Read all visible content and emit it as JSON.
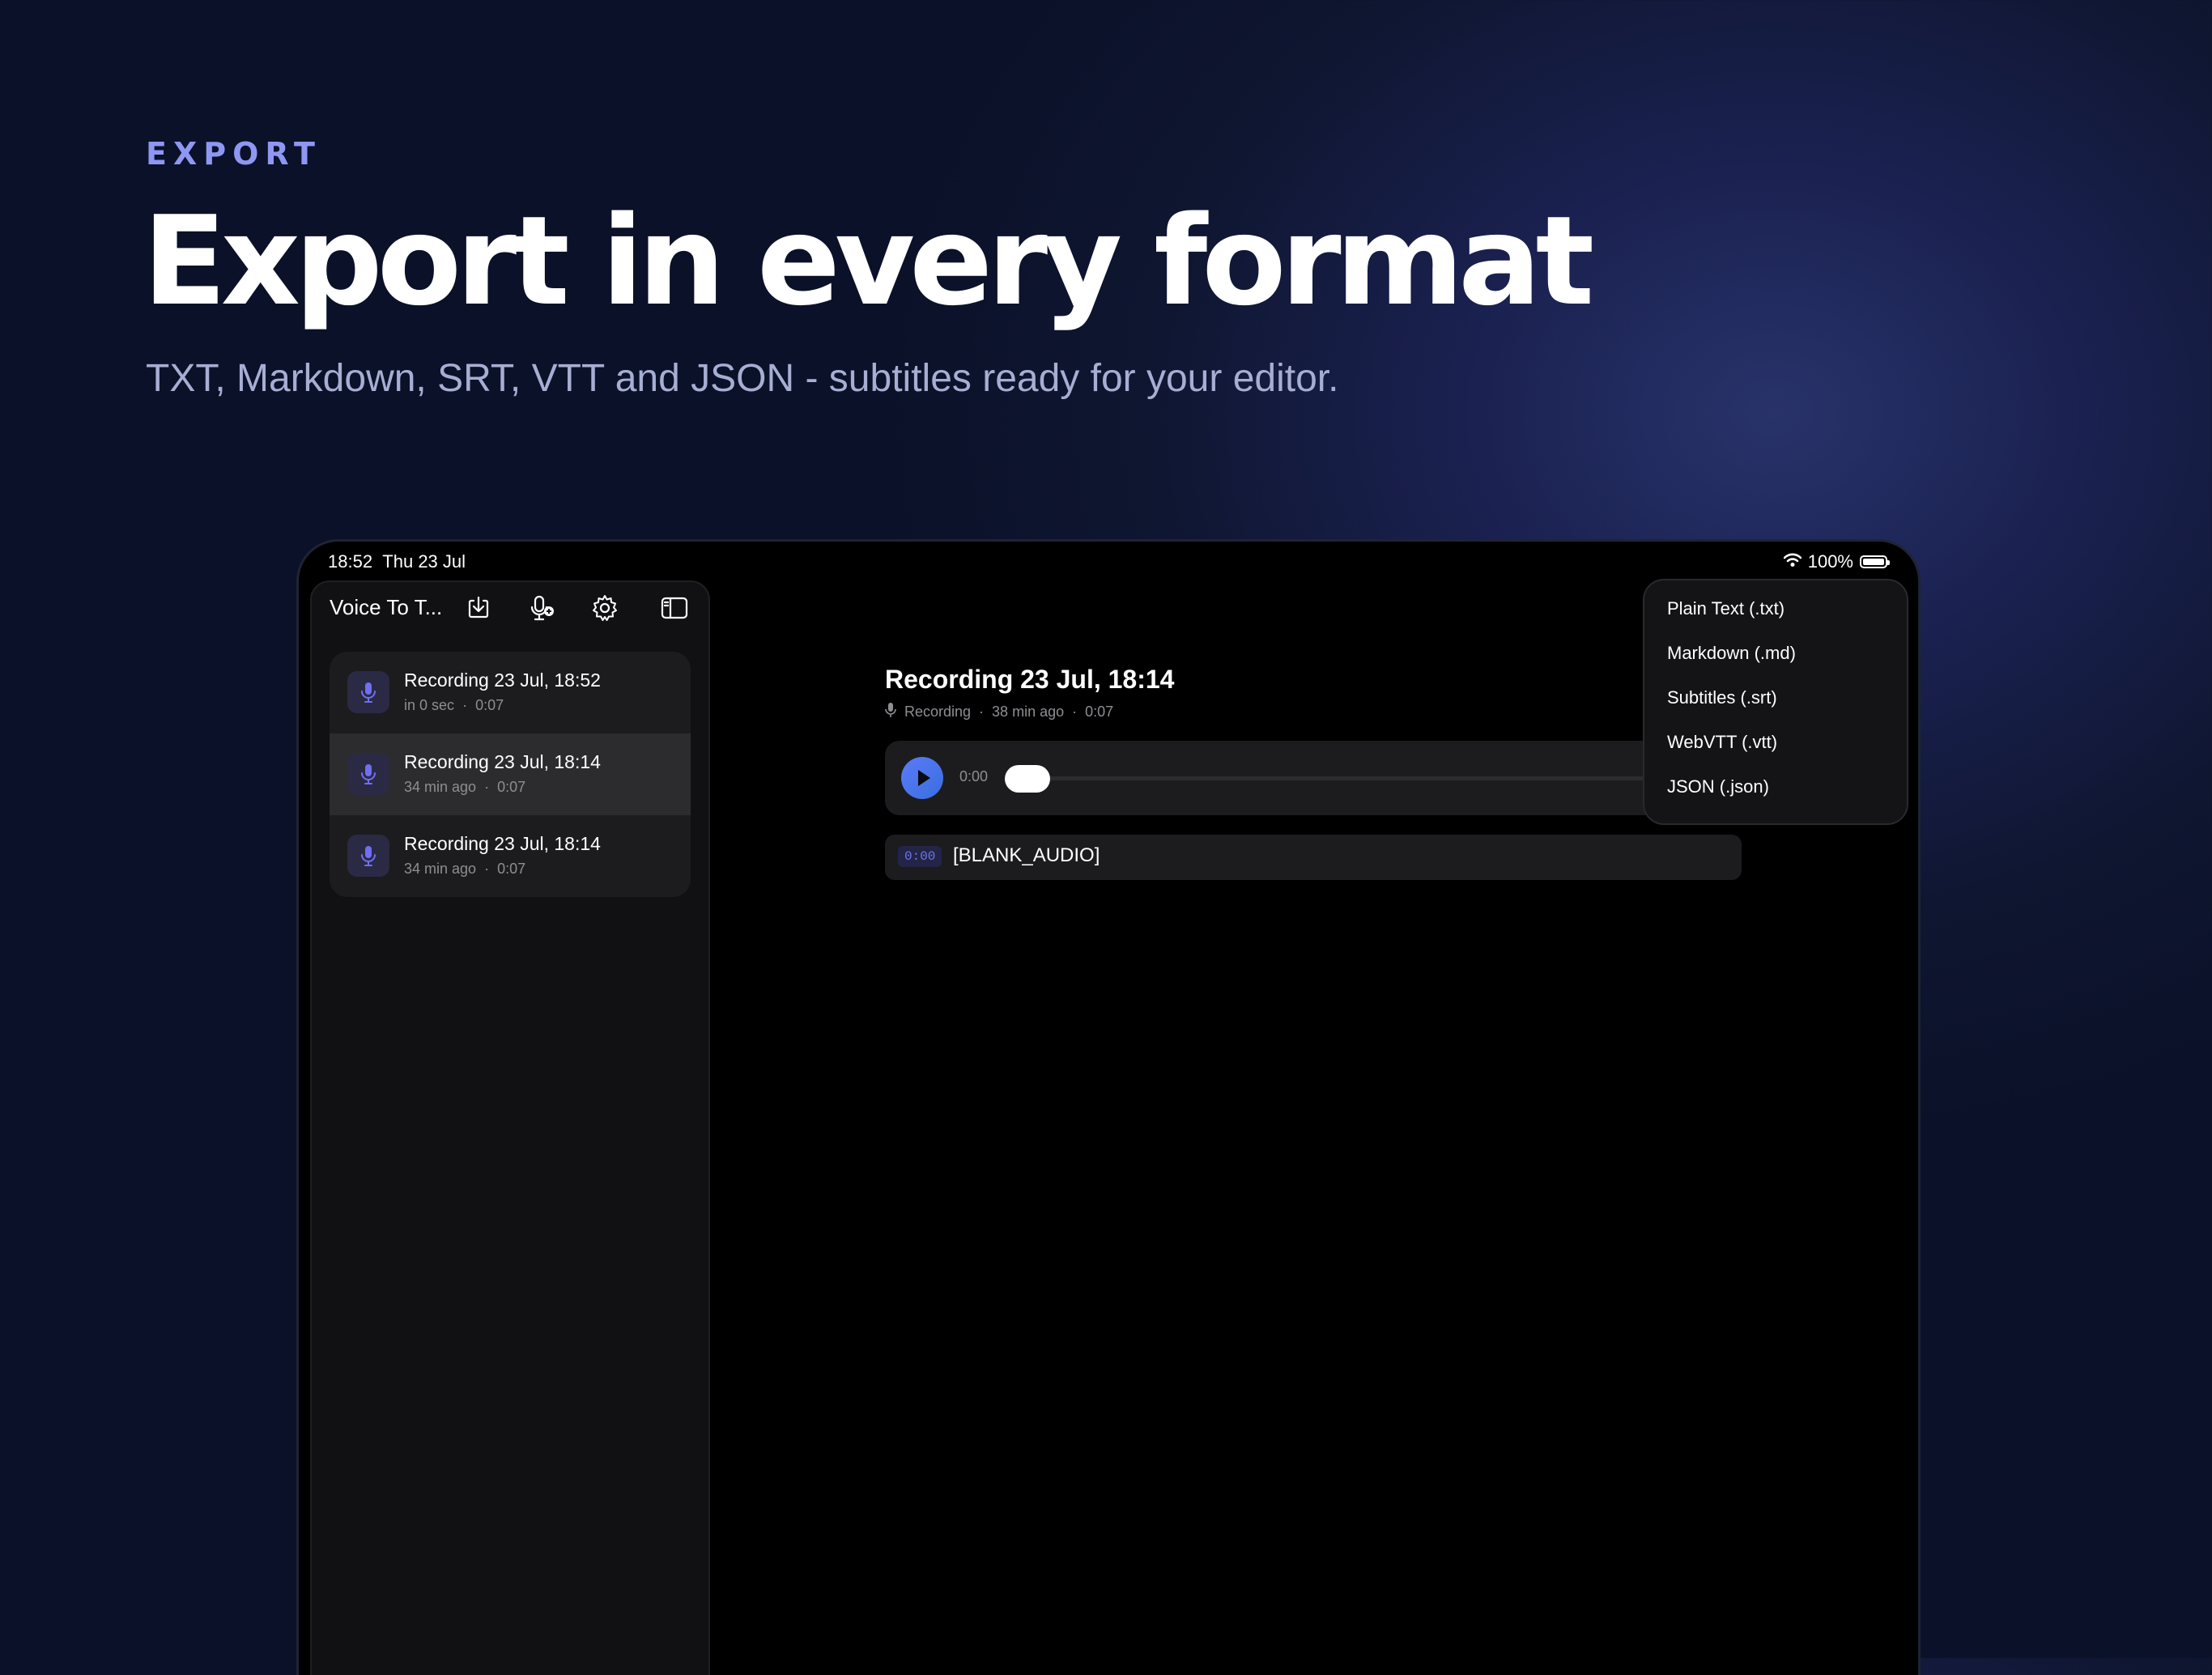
{
  "hero": {
    "eyebrow": "EXPORT",
    "headline": "Export in every format",
    "subhead": "TXT, Markdown, SRT, VTT and JSON - subtitles ready for your editor."
  },
  "status_bar": {
    "time": "18:52",
    "date": "Thu 23 Jul",
    "battery": "100%"
  },
  "sidebar": {
    "title": "Voice To T...",
    "toolbar_icons": [
      "download-icon",
      "mic-plus-icon",
      "gear-icon",
      "sidebar-toggle-icon"
    ],
    "recordings": [
      {
        "title": "Recording 23 Jul, 18:52",
        "when": "in 0 sec",
        "duration": "0:07"
      },
      {
        "title": "Recording 23 Jul, 18:14",
        "when": "34 min ago",
        "duration": "0:07"
      },
      {
        "title": "Recording 23 Jul, 18:14",
        "when": "34 min ago",
        "duration": "0:07"
      }
    ],
    "sep": "·"
  },
  "detail": {
    "title": "Recording 23 Jul, 18:14",
    "meta_type": "Recording",
    "meta_when": "38 min ago",
    "meta_duration": "0:07",
    "sep": "·",
    "player_time": "0:00",
    "segments": [
      {
        "time": "0:00",
        "text": "[BLANK_AUDIO]"
      }
    ]
  },
  "export_menu": {
    "items": [
      "Plain Text (.txt)",
      "Markdown (.md)",
      "Subtitles (.srt)",
      "WebVTT (.vtt)",
      "JSON (.json)"
    ]
  },
  "colors": {
    "accent": "#8e97f2",
    "play_button": "#4a74ec",
    "timestamp": "#6f77e8"
  }
}
